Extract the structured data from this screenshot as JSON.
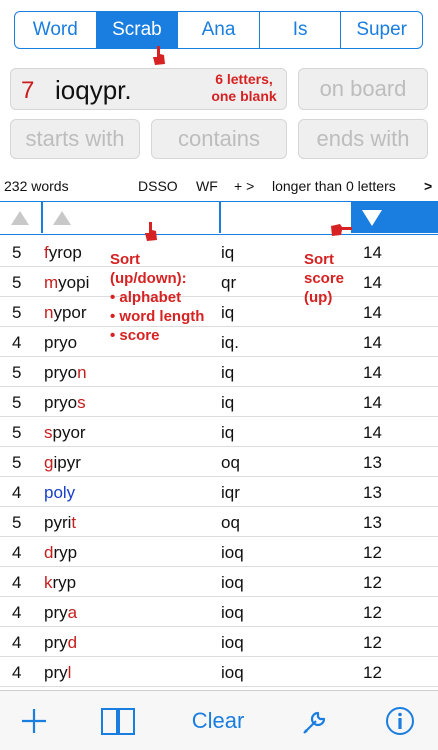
{
  "tabs": [
    "Word",
    "Scrab",
    "Ana",
    "Is",
    "Super"
  ],
  "active_tab": "Scrab",
  "rack": {
    "count": "7",
    "letters": "ioqypr.",
    "note_line1": "6 letters,",
    "note_line2": "one blank"
  },
  "on_board_placeholder": "on board",
  "starts_with_placeholder": "starts with",
  "contains_placeholder": "contains",
  "ends_with_placeholder": "ends with",
  "status": {
    "word_count": "232 words",
    "dict": "DSSO",
    "wf": "WF",
    "plus": "+ >",
    "longer": "longer than 0 letters",
    "longer_chevron": ">"
  },
  "annotations": {
    "sort_title": "Sort",
    "sort_line2": "(up/down):",
    "sort_items": [
      "• alphabet",
      "• word length",
      "• score"
    ],
    "score_title": "Sort",
    "score_line2": "score",
    "score_line3": "(up)"
  },
  "rows": [
    {
      "len": "5",
      "word": [
        {
          "t": "f",
          "c": "red"
        },
        {
          "t": "yrop",
          "c": ""
        }
      ],
      "hooks": "iq",
      "score": "14"
    },
    {
      "len": "5",
      "word": [
        {
          "t": "m",
          "c": "red"
        },
        {
          "t": "yopi",
          "c": ""
        }
      ],
      "hooks": "qr",
      "score": "14"
    },
    {
      "len": "5",
      "word": [
        {
          "t": "n",
          "c": "red"
        },
        {
          "t": "ypor",
          "c": ""
        }
      ],
      "hooks": "iq",
      "score": "14"
    },
    {
      "len": "4",
      "word": [
        {
          "t": "pryo",
          "c": ""
        }
      ],
      "hooks": "iq.",
      "score": "14"
    },
    {
      "len": "5",
      "word": [
        {
          "t": "pryo",
          "c": ""
        },
        {
          "t": "n",
          "c": "red"
        }
      ],
      "hooks": "iq",
      "score": "14"
    },
    {
      "len": "5",
      "word": [
        {
          "t": "pryo",
          "c": ""
        },
        {
          "t": "s",
          "c": "red"
        }
      ],
      "hooks": "iq",
      "score": "14"
    },
    {
      "len": "5",
      "word": [
        {
          "t": "s",
          "c": "red"
        },
        {
          "t": "pyor",
          "c": ""
        }
      ],
      "hooks": "iq",
      "score": "14"
    },
    {
      "len": "5",
      "word": [
        {
          "t": "g",
          "c": "red"
        },
        {
          "t": "ipyr",
          "c": ""
        }
      ],
      "hooks": "oq",
      "score": "13"
    },
    {
      "len": "4",
      "word": [
        {
          "t": "poly",
          "c": "blue"
        }
      ],
      "hooks": "iqr",
      "score": "13"
    },
    {
      "len": "5",
      "word": [
        {
          "t": "pyri",
          "c": ""
        },
        {
          "t": "t",
          "c": "red"
        }
      ],
      "hooks": "oq",
      "score": "13"
    },
    {
      "len": "4",
      "word": [
        {
          "t": "d",
          "c": "red"
        },
        {
          "t": "ryp",
          "c": ""
        }
      ],
      "hooks": "ioq",
      "score": "12"
    },
    {
      "len": "4",
      "word": [
        {
          "t": "k",
          "c": "red"
        },
        {
          "t": "ryp",
          "c": ""
        }
      ],
      "hooks": "ioq",
      "score": "12"
    },
    {
      "len": "4",
      "word": [
        {
          "t": "pry",
          "c": ""
        },
        {
          "t": "a",
          "c": "red"
        }
      ],
      "hooks": "ioq",
      "score": "12"
    },
    {
      "len": "4",
      "word": [
        {
          "t": "pry",
          "c": ""
        },
        {
          "t": "d",
          "c": "red"
        }
      ],
      "hooks": "ioq",
      "score": "12"
    },
    {
      "len": "4",
      "word": [
        {
          "t": "pry",
          "c": ""
        },
        {
          "t": "l",
          "c": "red"
        }
      ],
      "hooks": "ioq",
      "score": "12"
    }
  ],
  "toolbar": {
    "add_icon": "plus-icon",
    "book_icon": "book-icon",
    "clear_label": "Clear",
    "wrench_icon": "wrench-icon",
    "info_icon": "info-icon"
  },
  "colors": {
    "accent": "#1a7ee0",
    "highlight_red": "#c41e1e",
    "highlight_blue": "#1840c8",
    "annotation_red": "#d62222"
  }
}
